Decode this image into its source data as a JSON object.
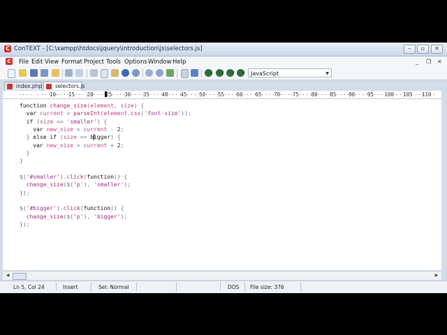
{
  "window": {
    "title": "ConTEXT - [C:\\xampp\\htdocs\\jquery\\introduction\\js\\selectors.js]",
    "app_icon": "C"
  },
  "menu": {
    "items": [
      "File",
      "Edit",
      "View",
      "Format",
      "Project",
      "Tools",
      "Options",
      "Window",
      "Help"
    ]
  },
  "toolbar": {
    "language": "JavaScript",
    "macro_labels": [
      "1",
      "2",
      "3",
      "4"
    ]
  },
  "tabs": [
    {
      "label": "index.php",
      "active": false
    },
    {
      "label": "selectors.js",
      "active": true
    }
  ],
  "ruler": {
    "marks": [
      "10",
      "15",
      "20",
      "25",
      "30",
      "35",
      "40",
      "45",
      "50",
      "55",
      "60",
      "65",
      "70",
      "75",
      "80",
      "85",
      "90",
      "95",
      "100",
      "105",
      "110"
    ]
  },
  "editor": {
    "lines": [
      "function change_size(element, size) {",
      "  var current = parseInt(element.css('font-size'));",
      "  if (size == 'smaller') {",
      "    var new_size = current - 2;",
      "  } else if (size == 'bigger') {",
      "    var new_size = current + 2;",
      "  }",
      "}",
      "",
      "$('#smaller').click(function() {",
      "  change_size($('p'), 'smaller');",
      "});",
      "",
      "$('#bigger').click(function() {",
      "  change_size($('p'), 'bigger');",
      "});"
    ]
  },
  "status": {
    "position": "Ln 5, Col 24",
    "mode": "Insert",
    "selection": "Sel: Normal",
    "line_endings": "DOS",
    "file_size": "File size: 376"
  },
  "colors": {
    "string": "#9c2f8c",
    "variable": "#c04090",
    "function": "#b02868"
  }
}
